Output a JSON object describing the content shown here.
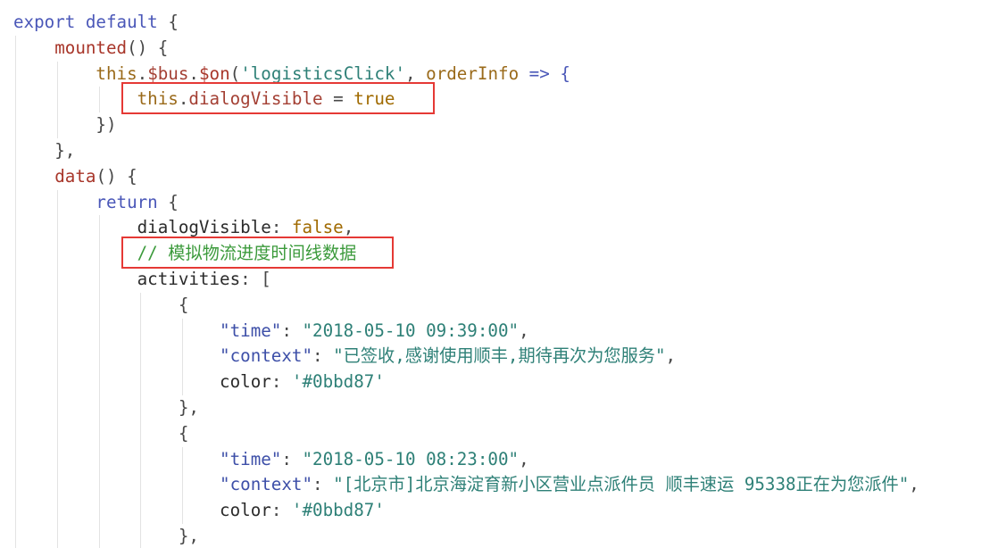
{
  "editor": {
    "lines": [
      [
        {
          "t": "export",
          "c": "kw"
        },
        {
          "t": " ",
          "c": "id"
        },
        {
          "t": "default",
          "c": "kw"
        },
        {
          "t": " ",
          "c": "id"
        },
        {
          "t": "{",
          "c": "punc"
        }
      ],
      [
        {
          "t": "    ",
          "c": "id"
        },
        {
          "t": "mounted",
          "c": "fn"
        },
        {
          "t": "() {",
          "c": "punc"
        }
      ],
      [
        {
          "t": "        ",
          "c": "id"
        },
        {
          "t": "this",
          "c": "this"
        },
        {
          "t": ".",
          "c": "punc"
        },
        {
          "t": "$bus",
          "c": "prop"
        },
        {
          "t": ".",
          "c": "punc"
        },
        {
          "t": "$on",
          "c": "fn"
        },
        {
          "t": "(",
          "c": "punc"
        },
        {
          "t": "'logisticsClick'",
          "c": "str"
        },
        {
          "t": ", ",
          "c": "punc"
        },
        {
          "t": "orderInfo",
          "c": "this"
        },
        {
          "t": " => {",
          "c": "arrow"
        }
      ],
      [
        {
          "t": "            ",
          "c": "id"
        },
        {
          "t": "this",
          "c": "this"
        },
        {
          "t": ".",
          "c": "punc"
        },
        {
          "t": "dialogVisible",
          "c": "prop"
        },
        {
          "t": " = ",
          "c": "punc"
        },
        {
          "t": "true",
          "c": "bool"
        }
      ],
      [
        {
          "t": "        ",
          "c": "id"
        },
        {
          "t": "})",
          "c": "punc"
        }
      ],
      [
        {
          "t": "    ",
          "c": "id"
        },
        {
          "t": "},",
          "c": "punc"
        }
      ],
      [
        {
          "t": "    ",
          "c": "id"
        },
        {
          "t": "data",
          "c": "fn"
        },
        {
          "t": "() {",
          "c": "punc"
        }
      ],
      [
        {
          "t": "        ",
          "c": "id"
        },
        {
          "t": "return",
          "c": "kw"
        },
        {
          "t": " {",
          "c": "punc"
        }
      ],
      [
        {
          "t": "            ",
          "c": "id"
        },
        {
          "t": "dialogVisible",
          "c": "id"
        },
        {
          "t": ": ",
          "c": "punc"
        },
        {
          "t": "false",
          "c": "bool"
        },
        {
          "t": ",",
          "c": "punc"
        }
      ],
      [
        {
          "t": "            ",
          "c": "id"
        },
        {
          "t": "// 模拟物流进度时间线数据",
          "c": "comment"
        }
      ],
      [
        {
          "t": "            ",
          "c": "id"
        },
        {
          "t": "activities",
          "c": "id"
        },
        {
          "t": ": [",
          "c": "punc"
        }
      ],
      [
        {
          "t": "                ",
          "c": "id"
        },
        {
          "t": "{",
          "c": "punc"
        }
      ],
      [
        {
          "t": "                    ",
          "c": "id"
        },
        {
          "t": "\"time\"",
          "c": "keystr"
        },
        {
          "t": ": ",
          "c": "punc"
        },
        {
          "t": "\"2018-05-10 09:39:00\"",
          "c": "str"
        },
        {
          "t": ",",
          "c": "punc"
        }
      ],
      [
        {
          "t": "                    ",
          "c": "id"
        },
        {
          "t": "\"context\"",
          "c": "keystr"
        },
        {
          "t": ": ",
          "c": "punc"
        },
        {
          "t": "\"已签收,感谢使用顺丰,期待再次为您服务\"",
          "c": "str"
        },
        {
          "t": ",",
          "c": "punc"
        }
      ],
      [
        {
          "t": "                    ",
          "c": "id"
        },
        {
          "t": "color",
          "c": "id"
        },
        {
          "t": ": ",
          "c": "punc"
        },
        {
          "t": "'#0bbd87'",
          "c": "str"
        }
      ],
      [
        {
          "t": "                ",
          "c": "id"
        },
        {
          "t": "},",
          "c": "punc"
        }
      ],
      [
        {
          "t": "                ",
          "c": "id"
        },
        {
          "t": "{",
          "c": "punc"
        }
      ],
      [
        {
          "t": "                    ",
          "c": "id"
        },
        {
          "t": "\"time\"",
          "c": "keystr"
        },
        {
          "t": ": ",
          "c": "punc"
        },
        {
          "t": "\"2018-05-10 08:23:00\"",
          "c": "str"
        },
        {
          "t": ",",
          "c": "punc"
        }
      ],
      [
        {
          "t": "                    ",
          "c": "id"
        },
        {
          "t": "\"context\"",
          "c": "keystr"
        },
        {
          "t": ": ",
          "c": "punc"
        },
        {
          "t": "\"[北京市]北京海淀育新小区营业点派件员 顺丰速运 95338正在为您派件\"",
          "c": "str"
        },
        {
          "t": ",",
          "c": "punc"
        }
      ],
      [
        {
          "t": "                    ",
          "c": "id"
        },
        {
          "t": "color",
          "c": "id"
        },
        {
          "t": ": ",
          "c": "punc"
        },
        {
          "t": "'#0bbd87'",
          "c": "str"
        }
      ],
      [
        {
          "t": "                ",
          "c": "id"
        },
        {
          "t": "},",
          "c": "punc"
        }
      ]
    ],
    "highlight_color": "#e53935",
    "highlighted_lines": [
      3,
      9
    ]
  }
}
